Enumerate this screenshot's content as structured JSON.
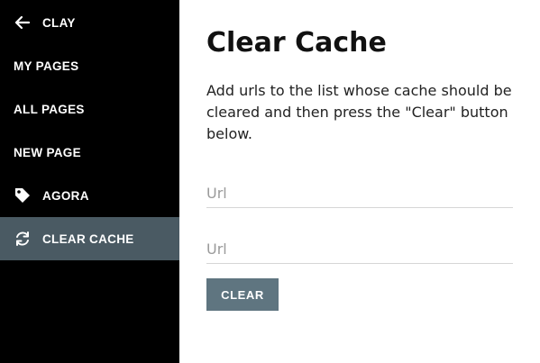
{
  "sidebar": {
    "back_label": "CLAY",
    "items": [
      {
        "label": "MY PAGES"
      },
      {
        "label": "ALL PAGES"
      },
      {
        "label": "NEW PAGE"
      },
      {
        "label": "AGORA",
        "icon": "tag-icon"
      },
      {
        "label": "CLEAR CACHE",
        "icon": "refresh-icon",
        "active": true
      }
    ],
    "colors": {
      "background": "#000000",
      "active": "#4a5a63",
      "text": "#ffffff"
    }
  },
  "main": {
    "title": "Clear Cache",
    "description": "Add urls to the list whose cache should be cleared and then press the \"Clear\" button below.",
    "url_fields": [
      {
        "placeholder": "Url",
        "value": ""
      },
      {
        "placeholder": "Url",
        "value": ""
      }
    ],
    "clear_label": "CLEAR",
    "button_color": "#5f7580"
  }
}
